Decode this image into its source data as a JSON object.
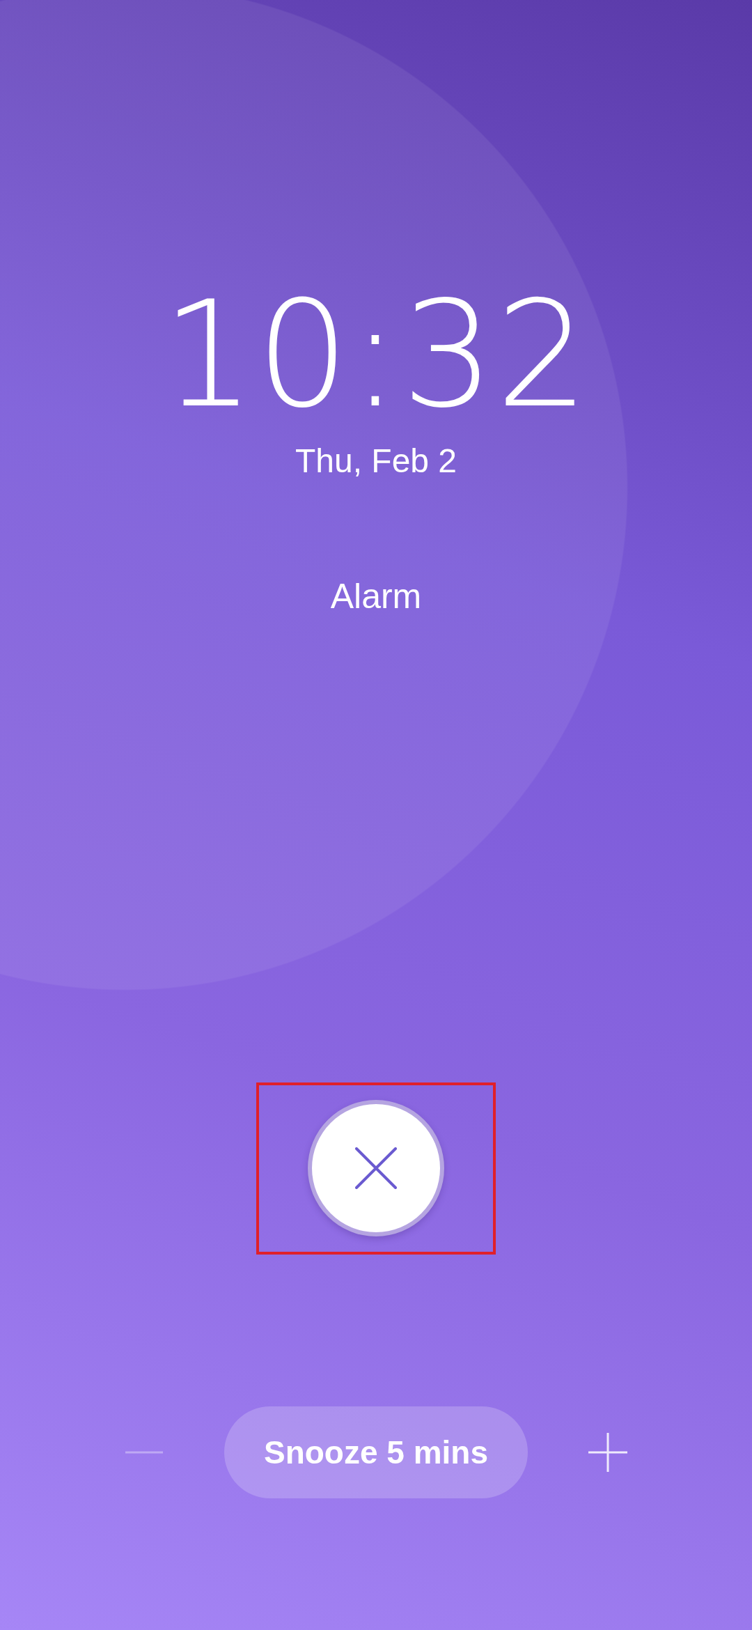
{
  "clock": {
    "time": "10:32",
    "date": "Thu, Feb 2"
  },
  "alarm": {
    "label": "Alarm"
  },
  "dismiss": {
    "highlighted": true
  },
  "snooze": {
    "label": "Snooze 5 mins"
  }
}
